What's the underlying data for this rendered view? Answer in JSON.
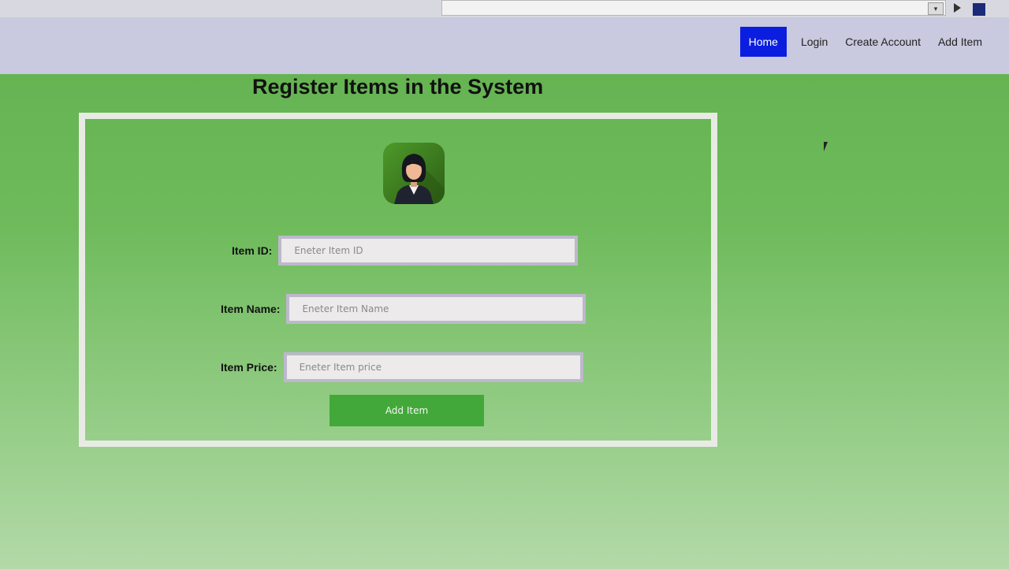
{
  "browser": {
    "dropdown_icon": "chevron-down-icon",
    "play_icon": "play-icon",
    "extension_icon": "extension-icon"
  },
  "nav": {
    "items": [
      {
        "label": "Home",
        "active": true
      },
      {
        "label": "Login",
        "active": false
      },
      {
        "label": "Create Account",
        "active": false
      },
      {
        "label": "Add Item",
        "active": false
      }
    ],
    "active_color": "#0b1ee0"
  },
  "page": {
    "title": "Register Items in the System",
    "background_color": "#6fbb5c"
  },
  "form": {
    "avatar_icon": "user-avatar-icon",
    "fields": [
      {
        "label": "Item ID:",
        "placeholder": "Eneter Item ID",
        "value": ""
      },
      {
        "label": "Item Name:",
        "placeholder": "Eneter Item Name",
        "value": ""
      },
      {
        "label": "Item Price:",
        "placeholder": "Eneter Item price",
        "value": ""
      }
    ],
    "submit_label": "Add Item",
    "submit_color": "#43a83a"
  }
}
